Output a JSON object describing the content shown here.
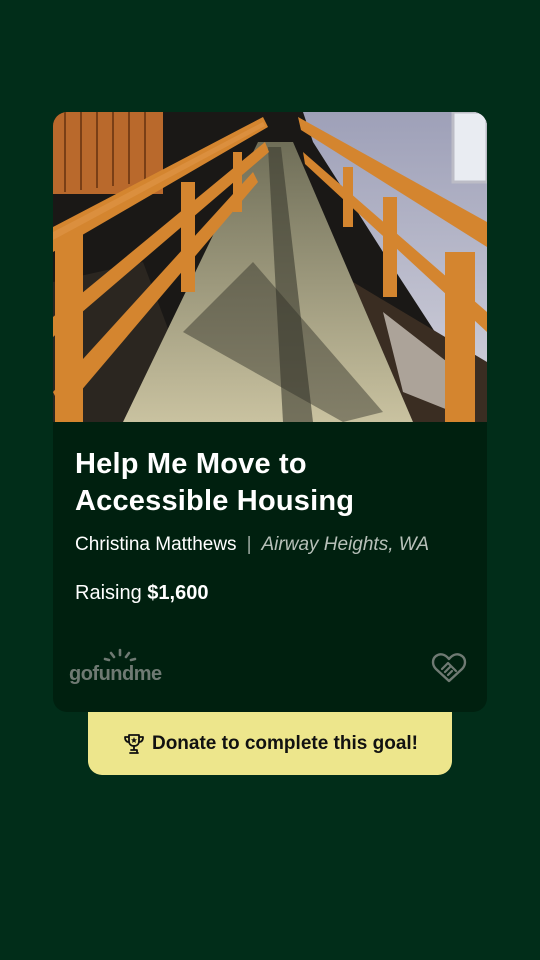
{
  "campaign": {
    "title": "Help Me Move to Accessible Housing",
    "organizer": "Christina Matthews",
    "separator": "|",
    "location": "Airway Heights, WA",
    "raising_prefix": "Raising",
    "raising_amount": "$1,600"
  },
  "branding": {
    "logo_text": "gofundme",
    "logo_icon": "gofundme-sunrise-icon",
    "heart_icon": "heart-handshake-icon"
  },
  "cta": {
    "label": "Donate to complete this goal!",
    "icon": "trophy-icon"
  },
  "image": {
    "subject": "wooden-wheelchair-ramp-photo"
  },
  "colors": {
    "background": "#012d19",
    "card": "#00200f",
    "cta_background": "#ede68c",
    "muted_text": "#b7c0b9"
  }
}
